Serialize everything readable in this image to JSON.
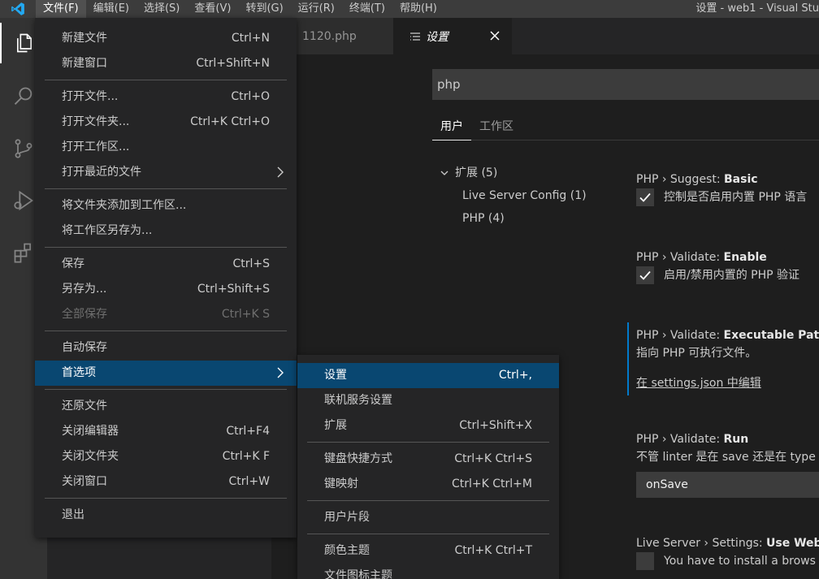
{
  "titlebar": {
    "menus": [
      "文件(F)",
      "编辑(E)",
      "选择(S)",
      "查看(V)",
      "转到(G)",
      "运行(R)",
      "终端(T)",
      "帮助(H)"
    ],
    "window_title": "设置 - web1 - Visual Stu"
  },
  "activity_bar": {
    "items": [
      "files-icon",
      "search-icon",
      "source-control-icon",
      "run-debug-icon",
      "extensions-icon"
    ]
  },
  "tabs": {
    "inactive_label": "1120.php",
    "active_label": "设置"
  },
  "settings": {
    "search_value": "php",
    "scope_tabs": [
      "用户",
      "工作区"
    ],
    "toc": {
      "group": "扩展 (5)",
      "children": [
        "Live Server Config (1)",
        "PHP (4)"
      ]
    },
    "items": [
      {
        "prefix": "PHP › Suggest: ",
        "name": "Basic",
        "desc": "控制是否启用内置 PHP 语言",
        "checked": true
      },
      {
        "prefix": "PHP › Validate: ",
        "name": "Enable",
        "desc": "启用/禁用内置的 PHP 验证",
        "checked": true
      },
      {
        "prefix": "PHP › Validate: ",
        "name": "Executable Path",
        "desc": "指向 PHP 可执行文件。",
        "link": "在 settings.json 中编辑"
      },
      {
        "prefix": "PHP › Validate: ",
        "name": "Run",
        "desc": "不管 linter 是在 save 还是在 type",
        "select_value": "onSave"
      },
      {
        "prefix": "Live Server › Settings: ",
        "name": "Use Web",
        "desc": "You have to install a brows",
        "checked": false
      }
    ]
  },
  "file_menu": {
    "items": [
      {
        "label": "新建文件",
        "kb": "Ctrl+N"
      },
      {
        "label": "新建窗口",
        "kb": "Ctrl+Shift+N"
      },
      {
        "sep": true
      },
      {
        "label": "打开文件...",
        "kb": "Ctrl+O"
      },
      {
        "label": "打开文件夹...",
        "kb": "Ctrl+K Ctrl+O"
      },
      {
        "label": "打开工作区..."
      },
      {
        "label": "打开最近的文件",
        "submenu": true
      },
      {
        "sep": true
      },
      {
        "label": "将文件夹添加到工作区..."
      },
      {
        "label": "将工作区另存为..."
      },
      {
        "sep": true
      },
      {
        "label": "保存",
        "kb": "Ctrl+S"
      },
      {
        "label": "另存为...",
        "kb": "Ctrl+Shift+S"
      },
      {
        "label": "全部保存",
        "kb": "Ctrl+K S",
        "disabled": true
      },
      {
        "sep": true
      },
      {
        "label": "自动保存"
      },
      {
        "label": "首选项",
        "submenu": true,
        "highlighted": true
      },
      {
        "sep": true
      },
      {
        "label": "还原文件"
      },
      {
        "label": "关闭编辑器",
        "kb": "Ctrl+F4"
      },
      {
        "label": "关闭文件夹",
        "kb": "Ctrl+K F"
      },
      {
        "label": "关闭窗口",
        "kb": "Ctrl+W"
      },
      {
        "sep": true
      },
      {
        "label": "退出"
      }
    ]
  },
  "pref_menu": {
    "items": [
      {
        "label": "设置",
        "kb": "Ctrl+,",
        "highlighted": true
      },
      {
        "label": "联机服务设置"
      },
      {
        "label": "扩展",
        "kb": "Ctrl+Shift+X"
      },
      {
        "sep": true
      },
      {
        "label": "键盘快捷方式",
        "kb": "Ctrl+K Ctrl+S"
      },
      {
        "label": "键映射",
        "kb": "Ctrl+K Ctrl+M"
      },
      {
        "sep": true
      },
      {
        "label": "用户片段"
      },
      {
        "sep": true
      },
      {
        "label": "颜色主题",
        "kb": "Ctrl+K Ctrl+T"
      },
      {
        "label": "文件图标主题"
      }
    ]
  },
  "colors": {
    "accent": "#007acc",
    "menu_highlight": "#094771",
    "logo": "#23a9f2"
  }
}
